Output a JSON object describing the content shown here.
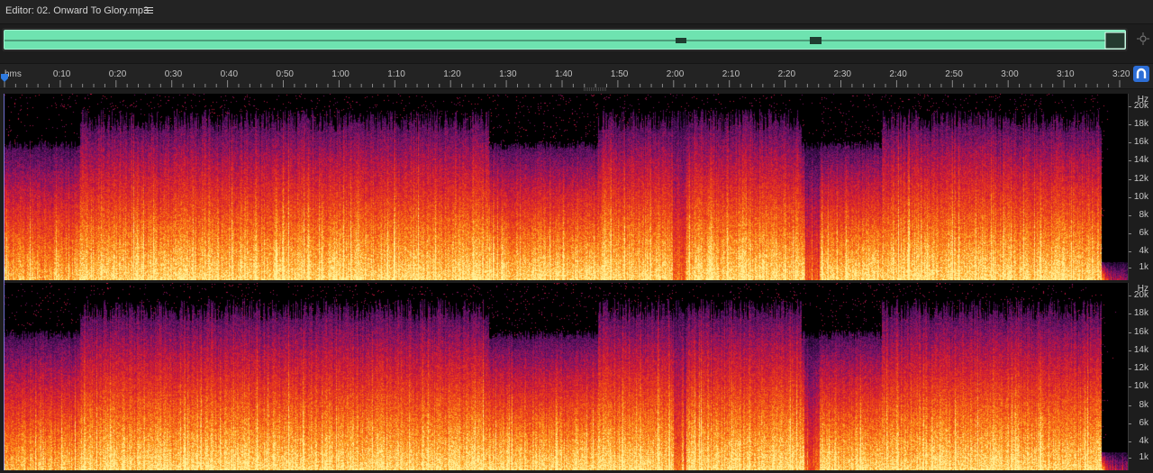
{
  "editor": {
    "title": "Editor: 02. Onward To Glory.mp3",
    "menu_icon": "hamburger-menu-icon"
  },
  "overview": {
    "waveform_color": "#6ee3b0",
    "zoom_icon": "zoom-navigator-icon"
  },
  "timeline": {
    "unit_label": "hms",
    "labels": [
      "0:10",
      "0:20",
      "0:30",
      "0:40",
      "0:50",
      "1:00",
      "1:10",
      "1:20",
      "1:30",
      "1:40",
      "1:50",
      "2:00",
      "2:10",
      "2:20",
      "2:30",
      "2:40",
      "2:50",
      "3:00",
      "3:10",
      "3:20"
    ],
    "snap_icon": "magnet-snap-icon",
    "playhead_icon": "playhead-marker-icon"
  },
  "spectral": {
    "unit": "Hz",
    "scale_labels": [
      "20k",
      "18k",
      "16k",
      "14k",
      "12k",
      "10k",
      "8k",
      "6k",
      "4k",
      "1k"
    ],
    "channels": [
      "left",
      "right"
    ],
    "colors": {
      "low": "#000000",
      "mid": "#c0104a",
      "high": "#ff7a1a",
      "peak": "#fff2a0"
    }
  }
}
